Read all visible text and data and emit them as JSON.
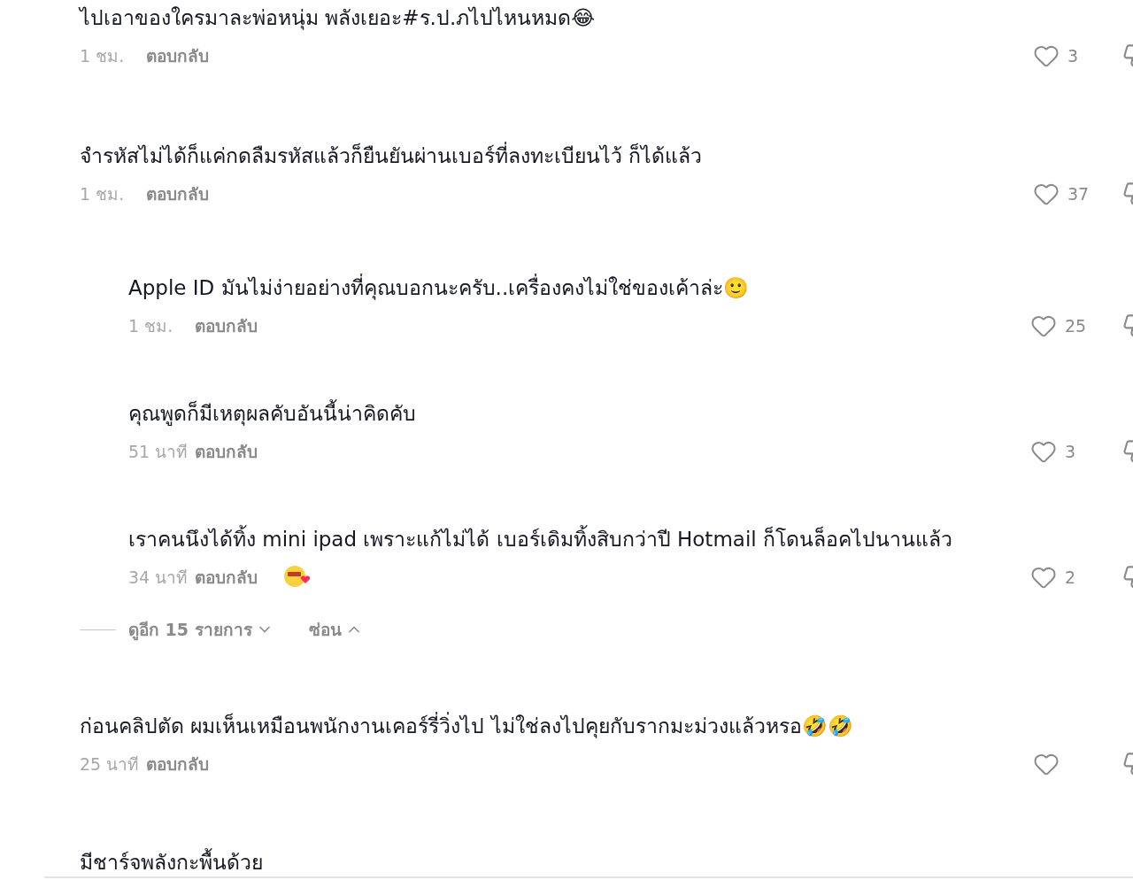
{
  "comments": [
    {
      "text": "ไปเอาของใครมาละพ่อหนุ่ม พลังเยอะ#ร.ป.ภไปไหนหมด😂",
      "time": "1 ชม.",
      "reply_label": "ตอบกลับ",
      "likes": "3",
      "creator_liked": false
    },
    {
      "text": "จำรหัสไม่ได้ก็แค่กดลืมรหัสแล้วก็ยืนยันผ่านเบอร์ที่ลงทะเบียนไว้ ก็ได้แล้ว",
      "time": "1 ชม.",
      "reply_label": "ตอบกลับ",
      "likes": "37",
      "creator_liked": false,
      "replies": [
        {
          "text": "Apple ID มันไม่ง่ายอย่างที่คุณบอกนะครับ..เครื่องคงไม่ใช่ของเค้าล่ะ🙂",
          "time": "1 ชม.",
          "reply_label": "ตอบกลับ",
          "likes": "25",
          "creator_liked": false
        },
        {
          "text": "คุณพูดก็มีเหตุผลคับอันนี้น่าคิดคับ",
          "time": "51 นาที",
          "reply_label": "ตอบกลับ",
          "likes": "3",
          "creator_liked": false
        },
        {
          "text": "เราคนนึงได้ทิ้ง mini ipad เพราะแก้ไม่ได้ เบอร์เดิมทิ้งสิบกว่าปี Hotmail ก็โดนล็อคไปนานแล้ว",
          "time": "34 นาที",
          "reply_label": "ตอบกลับ",
          "likes": "2",
          "creator_liked": true
        }
      ],
      "view_more": "ดูอีก 15 รายการ",
      "hide": "ซ่อน"
    },
    {
      "text": "ก่อนคลิปตัด ผมเห็นเหมือนพนักงานเคอร์รี่วิ่งไป ไม่ใช่ลงไปคุยกับรากมะม่วงแล้วหรอ🤣🤣",
      "time": "25 นาที",
      "reply_label": "ตอบกลับ",
      "creator_liked": false
    },
    {
      "text": "มีชาร์จพลังกะพื้นด้วย"
    }
  ]
}
